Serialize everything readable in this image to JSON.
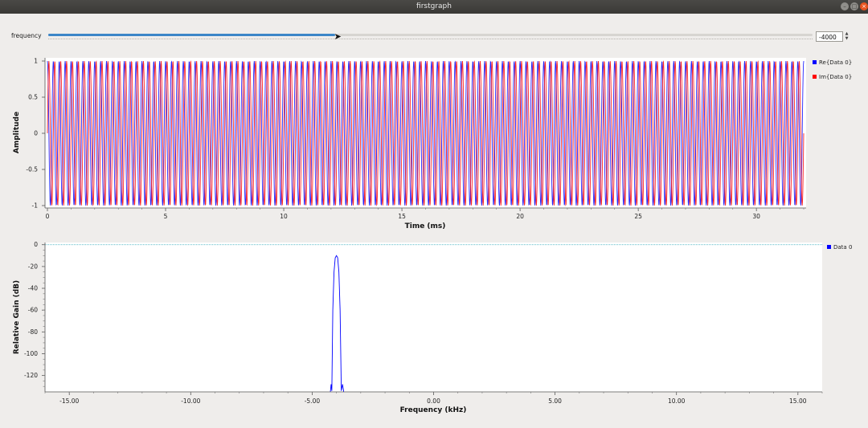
{
  "window": {
    "title": "firstgraph"
  },
  "controls": {
    "frequency_label": "frequency",
    "frequency_value": "-4000",
    "slider_fraction": 0.375
  },
  "time_plot": {
    "xlabel": "Time (ms)",
    "ylabel": "Amplitude",
    "x_ticks": [
      "0",
      "5",
      "10",
      "15",
      "20",
      "25",
      "30"
    ],
    "y_ticks": [
      "1",
      "0.5",
      "0",
      "-0.5",
      "-1"
    ],
    "legend": [
      {
        "label": "Re{Data 0}",
        "color": "#0000ff"
      },
      {
        "label": "Im{Data 0}",
        "color": "#ff0000"
      }
    ]
  },
  "freq_plot": {
    "xlabel": "Frequency (kHz)",
    "ylabel": "Relative Gain (dB)",
    "x_ticks": [
      "-15.00",
      "-10.00",
      "-5.00",
      "0.00",
      "5.00",
      "10.00",
      "15.00"
    ],
    "y_ticks": [
      "0",
      "-20",
      "-40",
      "-60",
      "-80",
      "-100",
      "-120"
    ],
    "legend": [
      {
        "label": "Data 0",
        "color": "#0000ff"
      }
    ]
  },
  "chart_data": [
    {
      "type": "line",
      "series": [
        {
          "name": "Re{Data 0}",
          "color": "#0000ff",
          "kind": "cos",
          "frequency_khz": 4.0
        },
        {
          "name": "Im{Data 0}",
          "color": "#ff0000",
          "kind": "sin",
          "frequency_khz": -4.0
        }
      ],
      "xlabel": "Time (ms)",
      "ylabel": "Amplitude",
      "xlim": [
        0,
        32
      ],
      "ylim": [
        -1,
        1
      ],
      "grid": false,
      "legend": "top-right"
    },
    {
      "type": "line",
      "series": [
        {
          "name": "Data 0",
          "color": "#0000ff",
          "peak_khz": -4.0,
          "peak_db": -10,
          "floor_db": -135
        }
      ],
      "xlabel": "Frequency (kHz)",
      "ylabel": "Relative Gain (dB)",
      "xlim": [
        -16,
        16
      ],
      "ylim": [
        -135,
        2
      ],
      "grid": false,
      "legend": "top-right"
    }
  ]
}
